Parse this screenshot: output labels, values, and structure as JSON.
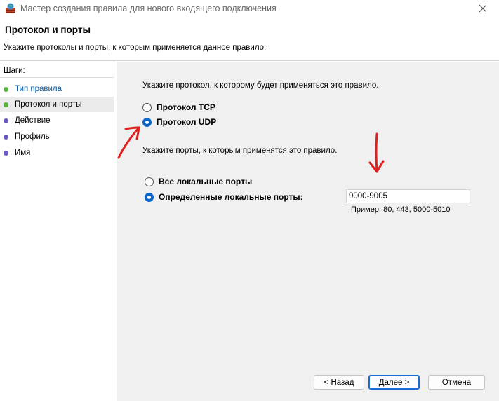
{
  "window": {
    "title": "Мастер создания правила для нового входящего подключения",
    "app_icon": "firewall-icon",
    "close_icon": "close-icon"
  },
  "header": {
    "title": "Протокол и порты",
    "subtitle": "Укажите протоколы и порты, к которым применяется данное правило."
  },
  "sidebar": {
    "heading": "Шаги:",
    "steps": [
      {
        "label": "Тип правила",
        "state": "done",
        "color": "#57b33b"
      },
      {
        "label": "Протокол и порты",
        "state": "active",
        "color": "#57b33b"
      },
      {
        "label": "Действие",
        "state": "pending",
        "color": "#6b5fc6"
      },
      {
        "label": "Профиль",
        "state": "pending",
        "color": "#6b5fc6"
      },
      {
        "label": "Имя",
        "state": "pending",
        "color": "#6b5fc6"
      }
    ]
  },
  "main": {
    "protocol_prompt": "Укажите протокол, к которому будет применяться это правило.",
    "protocols": [
      {
        "label": "Протокол TCP",
        "checked": false
      },
      {
        "label": "Протокол UDP",
        "checked": true
      }
    ],
    "ports_prompt": "Укажите порты, к которым применятся это правило.",
    "port_options": [
      {
        "label": "Все локальные порты",
        "checked": false
      },
      {
        "label": "Определенные локальные порты:",
        "checked": true
      }
    ],
    "ports_value": "9000-9005",
    "ports_example": "Пример: 80, 443, 5000-5010"
  },
  "buttons": {
    "back": "< Назад",
    "next": "Далее >",
    "cancel": "Отмена"
  },
  "colors": {
    "accent": "#0a63c9",
    "annotation": "#e0201e",
    "panel_bg": "#f0f0f0"
  }
}
